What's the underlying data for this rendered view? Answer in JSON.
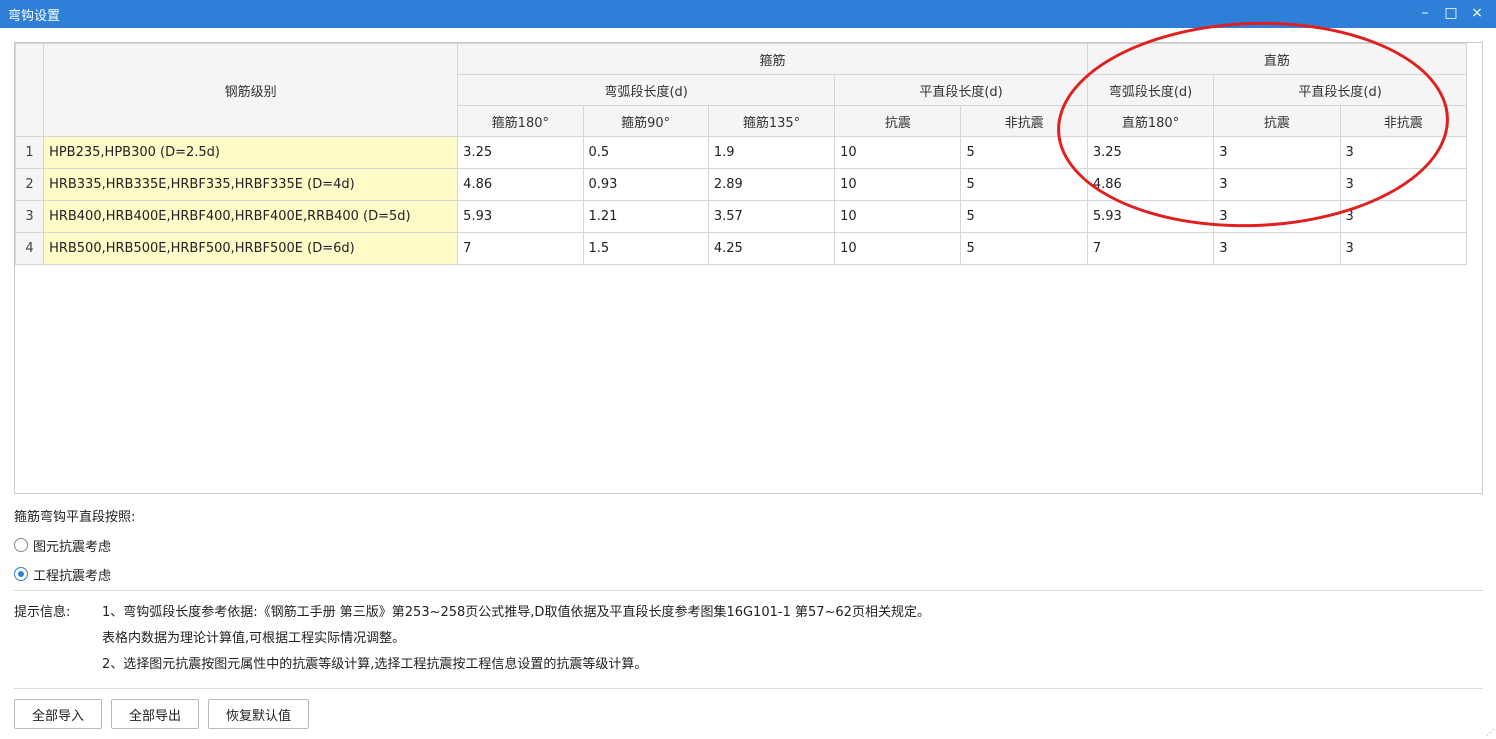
{
  "window": {
    "title": "弯钩设置",
    "minimize": "–",
    "maximize": "□",
    "close": "×"
  },
  "table": {
    "header": {
      "grade": "钢筋级别",
      "stirrup": "箍筋",
      "straight": "直筋",
      "arc_len": "弯弧段长度(d)",
      "flat_len": "平直段长度(d)",
      "s_arc_len": "弯弧段长度(d)",
      "s_flat_len": "平直段长度(d)",
      "cols": [
        "箍筋180°",
        "箍筋90°",
        "箍筋135°",
        "抗震",
        "非抗震",
        "直筋180°",
        "抗震",
        "非抗震"
      ]
    },
    "rows": [
      {
        "num": "1",
        "grade": "HPB235,HPB300 (D=2.5d)",
        "v": [
          "3.25",
          "0.5",
          "1.9",
          "10",
          "5",
          "3.25",
          "3",
          "3"
        ]
      },
      {
        "num": "2",
        "grade": "HRB335,HRB335E,HRBF335,HRBF335E (D=4d)",
        "v": [
          "4.86",
          "0.93",
          "2.89",
          "10",
          "5",
          "4.86",
          "3",
          "3"
        ]
      },
      {
        "num": "3",
        "grade": "HRB400,HRB400E,HRBF400,HRBF400E,RRB400 (D=5d)",
        "v": [
          "5.93",
          "1.21",
          "3.57",
          "10",
          "5",
          "5.93",
          "3",
          "3"
        ]
      },
      {
        "num": "4",
        "grade": "HRB500,HRB500E,HRBF500,HRBF500E (D=6d)",
        "v": [
          "7",
          "1.5",
          "4.25",
          "10",
          "5",
          "7",
          "3",
          "3"
        ]
      }
    ]
  },
  "settings": {
    "label": "箍筋弯钩平直段按照:",
    "options": [
      {
        "label": "图元抗震考虑",
        "selected": false
      },
      {
        "label": "工程抗震考虑",
        "selected": true
      }
    ]
  },
  "tips": {
    "head": "提示信息:",
    "lines": [
      "1、弯钩弧段长度参考依据:《钢筋工手册 第三版》第253~258页公式推导,D取值依据及平直段长度参考图集16G101-1 第57~62页相关规定。",
      "表格内数据为理论计算值,可根据工程实际情况调整。",
      "2、选择图元抗震按图元属性中的抗震等级计算,选择工程抗震按工程信息设置的抗震等级计算。"
    ]
  },
  "buttons": {
    "import_all": "全部导入",
    "export_all": "全部导出",
    "restore_default": "恢复默认值"
  },
  "colors": {
    "titlebar": "#2d7fd8",
    "grade_cell": "#fffbc9",
    "annotation_circle": "#e21f1f"
  }
}
